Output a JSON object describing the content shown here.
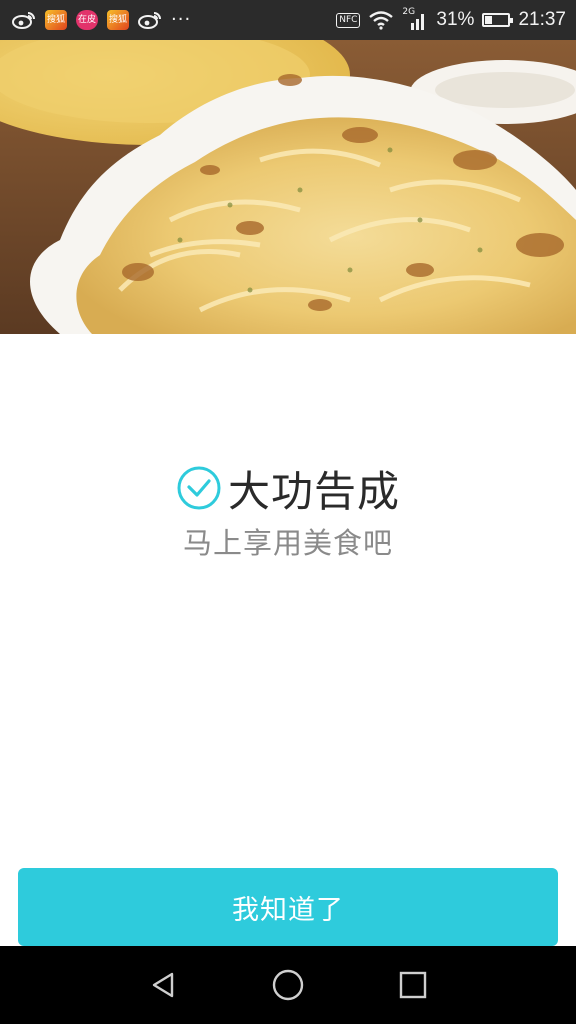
{
  "status_bar": {
    "nfc_label": "NFC",
    "network_label": "2G",
    "battery_text": "31%",
    "battery_level": 0.31,
    "time": "21:37",
    "app_icons": [
      "weibo-icon",
      "sohu-icon",
      "pink-app-icon",
      "sohu-icon",
      "weibo-icon"
    ],
    "badge_sohu_text": "搜狐",
    "badge_pink_text": "在皮",
    "more_indicator": "···"
  },
  "hero": {
    "image_name": "potato-gratin-photo"
  },
  "success": {
    "title": "大功告成",
    "subtitle": "马上享用美食吧",
    "accent_color": "#2ecbdc"
  },
  "actions": {
    "confirm_label": "我知道了"
  },
  "nav_bar": {
    "buttons": [
      "back-icon",
      "home-icon",
      "recents-icon"
    ]
  }
}
